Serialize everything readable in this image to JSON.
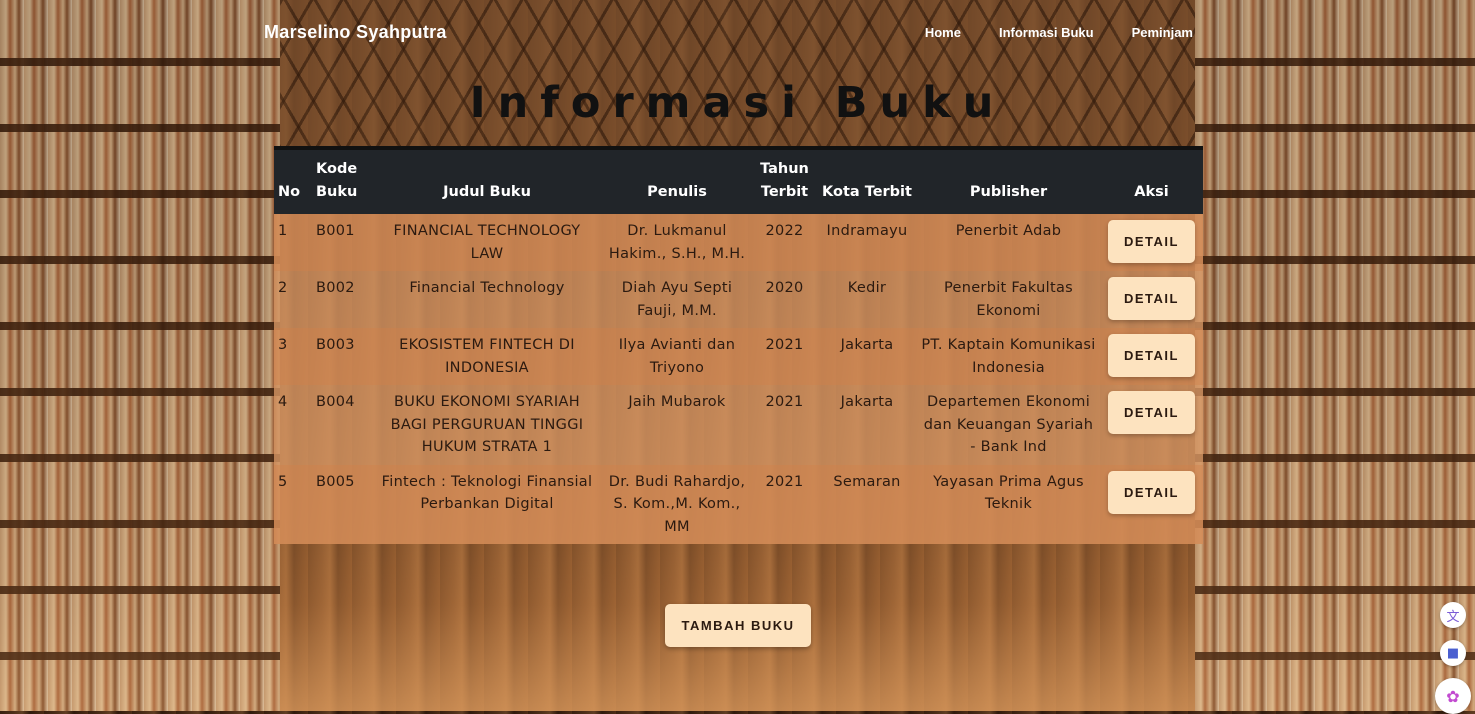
{
  "navbar": {
    "brand": "Marselino Syahputra",
    "links": [
      "Home",
      "Informasi Buku",
      "Peminjam"
    ]
  },
  "page_title": "Informasi Buku",
  "table": {
    "headers": {
      "no": "No",
      "kode": "Kode Buku",
      "judul": "Judul Buku",
      "penulis": "Penulis",
      "tahun": "Tahun Terbit",
      "kota": "Kota Terbit",
      "publisher": "Publisher",
      "aksi": "Aksi"
    },
    "rows": [
      {
        "no": "1",
        "kode": "B001",
        "judul": "FINANCIAL TECHNOLOGY LAW",
        "penulis": "Dr. Lukmanul Hakim., S.H., M.H.",
        "tahun": "2022",
        "kota": "Indramayu",
        "publisher": "Penerbit Adab",
        "action": "DETAIL"
      },
      {
        "no": "2",
        "kode": "B002",
        "judul": "Financial Technology",
        "penulis": "Diah Ayu Septi Fauji, M.M.",
        "tahun": "2020",
        "kota": "Kedir",
        "publisher": "Penerbit Fakultas Ekonomi",
        "action": "DETAIL"
      },
      {
        "no": "3",
        "kode": "B003",
        "judul": "EKOSISTEM FINTECH DI INDONESIA",
        "penulis": "Ilya Avianti dan Triyono",
        "tahun": "2021",
        "kota": "Jakarta",
        "publisher": "PT. Kaptain Komunikasi Indonesia",
        "action": "DETAIL"
      },
      {
        "no": "4",
        "kode": "B004",
        "judul": "BUKU EKONOMI SYARIAH BAGI PERGURUAN TINGGI HUKUM STRATA 1",
        "penulis": "Jaih Mubarok",
        "tahun": "2021",
        "kota": "Jakarta",
        "publisher": "Departemen Ekonomi dan Keuangan Syariah - Bank Ind",
        "action": "DETAIL"
      },
      {
        "no": "5",
        "kode": "B005",
        "judul": "Fintech : Teknologi Finansial Perbankan Digital",
        "penulis": "Dr. Budi Rahardjo, S. Kom.,M. Kom., MM",
        "tahun": "2021",
        "kota": "Semaran",
        "publisher": "Yayasan Prima Agus Teknik",
        "action": "DETAIL"
      }
    ]
  },
  "add_button": "TAMBAH BUKU",
  "side_icons": [
    "translate-icon",
    "book-icon",
    "brain-icon"
  ],
  "colors": {
    "header_bg": "#212529",
    "row_odd": "#d48c58",
    "row_even": "#d6966a",
    "button_bg": "#fde3bf"
  }
}
